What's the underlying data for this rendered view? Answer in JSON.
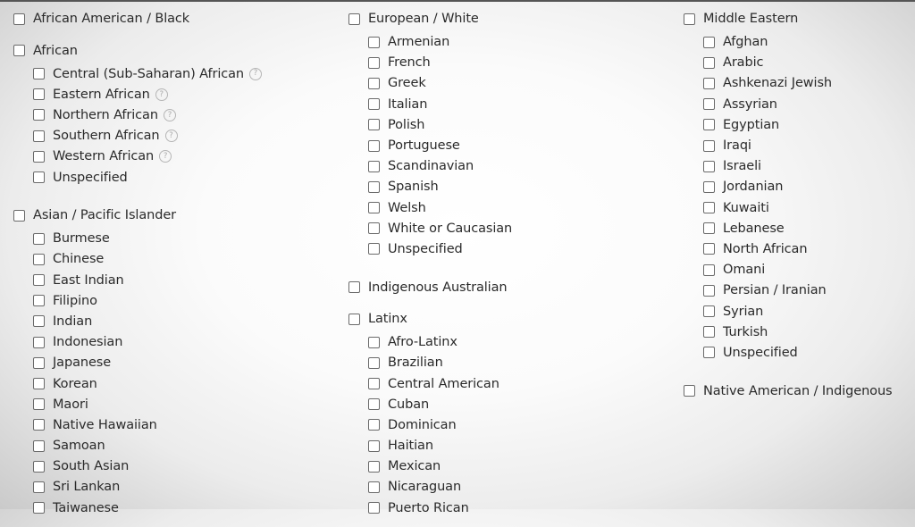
{
  "columns": [
    {
      "groups": [
        {
          "label": "African American / Black",
          "children": []
        },
        {
          "label": "African",
          "children": [
            {
              "label": "Central (Sub-Saharan) African",
              "help": true
            },
            {
              "label": "Eastern African",
              "help": true
            },
            {
              "label": "Northern African",
              "help": true
            },
            {
              "label": "Southern African",
              "help": true
            },
            {
              "label": "Western African",
              "help": true
            },
            {
              "label": "Unspecified",
              "help": false
            }
          ]
        },
        {
          "label": "Asian / Pacific Islander",
          "children": [
            {
              "label": "Burmese"
            },
            {
              "label": "Chinese"
            },
            {
              "label": "East Indian"
            },
            {
              "label": "Filipino"
            },
            {
              "label": "Indian"
            },
            {
              "label": "Indonesian"
            },
            {
              "label": "Japanese"
            },
            {
              "label": "Korean"
            },
            {
              "label": "Maori"
            },
            {
              "label": "Native Hawaiian"
            },
            {
              "label": "Samoan"
            },
            {
              "label": "South Asian"
            },
            {
              "label": "Sri Lankan"
            },
            {
              "label": "Taiwanese"
            }
          ]
        }
      ]
    },
    {
      "groups": [
        {
          "label": "European / White",
          "children": [
            {
              "label": "Armenian"
            },
            {
              "label": "French"
            },
            {
              "label": "Greek"
            },
            {
              "label": "Italian"
            },
            {
              "label": "Polish"
            },
            {
              "label": "Portuguese"
            },
            {
              "label": "Scandinavian"
            },
            {
              "label": "Spanish"
            },
            {
              "label": "Welsh"
            },
            {
              "label": "White or Caucasian"
            },
            {
              "label": "Unspecified"
            }
          ]
        },
        {
          "label": "Indigenous Australian",
          "children": []
        },
        {
          "label": "Latinx",
          "children": [
            {
              "label": "Afro-Latinx"
            },
            {
              "label": "Brazilian"
            },
            {
              "label": "Central American"
            },
            {
              "label": "Cuban"
            },
            {
              "label": "Dominican"
            },
            {
              "label": "Haitian"
            },
            {
              "label": "Mexican"
            },
            {
              "label": "Nicaraguan"
            },
            {
              "label": "Puerto Rican"
            }
          ]
        }
      ]
    },
    {
      "groups": [
        {
          "label": "Middle Eastern",
          "children": [
            {
              "label": "Afghan"
            },
            {
              "label": "Arabic"
            },
            {
              "label": "Ashkenazi Jewish"
            },
            {
              "label": "Assyrian"
            },
            {
              "label": "Egyptian"
            },
            {
              "label": "Iraqi"
            },
            {
              "label": "Israeli"
            },
            {
              "label": "Jordanian"
            },
            {
              "label": "Kuwaiti"
            },
            {
              "label": "Lebanese"
            },
            {
              "label": "North African"
            },
            {
              "label": "Omani"
            },
            {
              "label": "Persian / Iranian"
            },
            {
              "label": "Syrian"
            },
            {
              "label": "Turkish"
            },
            {
              "label": "Unspecified"
            }
          ]
        },
        {
          "label": "Native American / Indigenous",
          "children": []
        }
      ]
    }
  ],
  "help_glyph": "?"
}
